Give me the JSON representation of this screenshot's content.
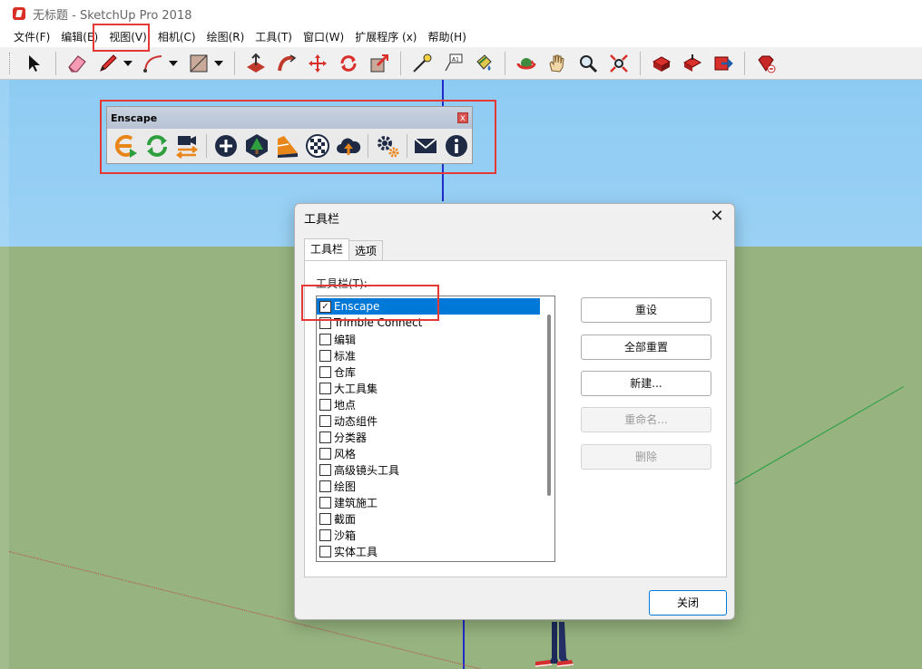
{
  "window": {
    "title": "无标题 - SketchUp Pro 2018"
  },
  "menu": {
    "items": [
      "文件(F)",
      "编辑(E)",
      "视图(V)",
      "相机(C)",
      "绘图(R)",
      "工具(T)",
      "窗口(W)",
      "扩展程序 (x)",
      "帮助(H)"
    ]
  },
  "enscape_toolbar": {
    "title": "Enscape",
    "close": "x"
  },
  "dialog": {
    "title": "工具栏",
    "close": "✕",
    "tabs": [
      "工具栏",
      "选项"
    ],
    "list_label": "工具栏(T):",
    "items": [
      {
        "label": "Enscape",
        "checked": true,
        "selected": true
      },
      {
        "label": "Trimble Connect",
        "checked": false
      },
      {
        "label": "编辑",
        "checked": false
      },
      {
        "label": "标准",
        "checked": false
      },
      {
        "label": "仓库",
        "checked": false
      },
      {
        "label": "大工具集",
        "checked": false
      },
      {
        "label": "地点",
        "checked": false
      },
      {
        "label": "动态组件",
        "checked": false
      },
      {
        "label": "分类器",
        "checked": false
      },
      {
        "label": "风格",
        "checked": false
      },
      {
        "label": "高级镜头工具",
        "checked": false
      },
      {
        "label": "绘图",
        "checked": false
      },
      {
        "label": "建筑施工",
        "checked": false
      },
      {
        "label": "截面",
        "checked": false
      },
      {
        "label": "沙箱",
        "checked": false
      },
      {
        "label": "实体工具",
        "checked": false
      }
    ],
    "buttons": {
      "reset": "重设",
      "reset_all": "全部重置",
      "new": "新建...",
      "rename": "重命名...",
      "delete": "删除"
    },
    "close_button": "关闭"
  },
  "colors": {
    "highlight": "#e53935",
    "selection": "#0078d7",
    "sky": "#8ecbf3",
    "ground": "#97b37f"
  }
}
